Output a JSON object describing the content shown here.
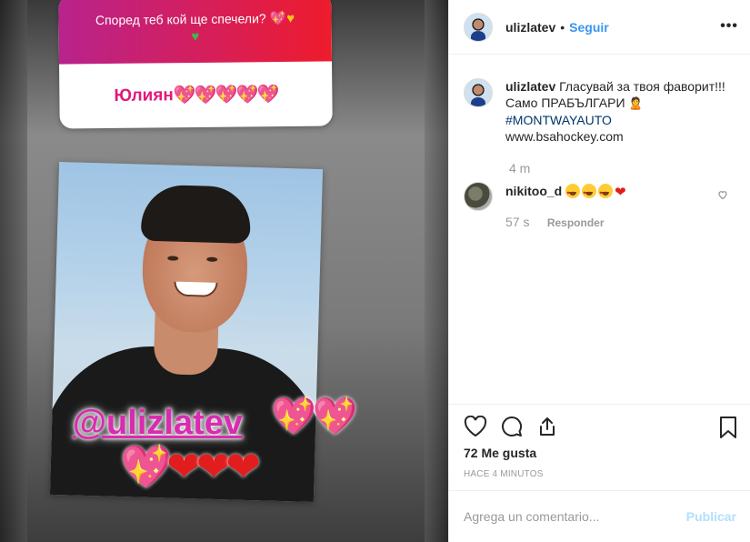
{
  "story": {
    "poll_question": "Според теб кой ще спечели?",
    "poll_option": "Юлиян",
    "mention": "@ulizlatev"
  },
  "post": {
    "author": "ulizlatev",
    "separator": "•",
    "follow_label": "Seguir",
    "more_label": "•••",
    "caption": {
      "username": "ulizlatev",
      "line1": "Гласувай за твоя фаворит!!!",
      "line2": "Само ПРАБЪЛГАРИ",
      "hashtag": "#MONTWAYAUTO",
      "link": "www.bsahockey.com"
    },
    "caption_time": "4 m",
    "comments": [
      {
        "username": "nikitoo_d",
        "time": "57 s",
        "reply_label": "Responder"
      }
    ],
    "likes": "72 Me gusta",
    "posted_ago": "HACE 4 MINUTOS",
    "comment_placeholder": "Agrega un comentario...",
    "publish_label": "Publicar"
  },
  "colors": {
    "link_blue": "#3897f0",
    "hashtag_blue": "#003569",
    "publish_disabled": "#b2dffc",
    "muted_gray": "#999999",
    "poll_gradient_start": "#b8238c",
    "poll_gradient_end": "#ee1c2c",
    "mention_pink": "#d92bb0"
  },
  "icons": {
    "like": "heart-outline-icon",
    "comment": "speech-bubble-icon",
    "share": "share-arrow-icon",
    "save": "bookmark-icon",
    "comment_like": "small-heart-icon",
    "options": "more-options-icon"
  }
}
